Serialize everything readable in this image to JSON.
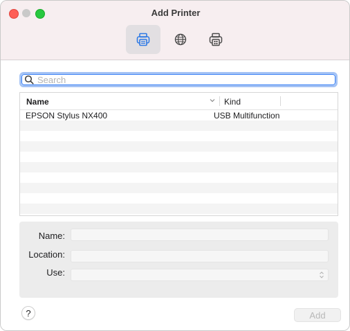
{
  "window": {
    "title": "Add Printer"
  },
  "toolbar": {
    "items": [
      {
        "icon": "default-printer-icon",
        "active": true
      },
      {
        "icon": "ip-globe-icon",
        "active": false
      },
      {
        "icon": "windows-printer-icon",
        "active": false
      }
    ]
  },
  "search": {
    "placeholder": "Search",
    "value": ""
  },
  "table": {
    "columns": [
      "Name",
      "Kind"
    ],
    "rows": [
      {
        "name": "EPSON Stylus NX400",
        "kind": "USB Multifunction"
      }
    ]
  },
  "details": {
    "name_label": "Name:",
    "name_value": "",
    "location_label": "Location:",
    "location_value": "",
    "use_label": "Use:",
    "use_value": ""
  },
  "footer": {
    "help_label": "?",
    "add_label": "Add"
  },
  "colors": {
    "accent": "#3b82f6",
    "titlebar": "#f7eef0",
    "close": "#fe5f57",
    "maximize": "#28c840"
  }
}
